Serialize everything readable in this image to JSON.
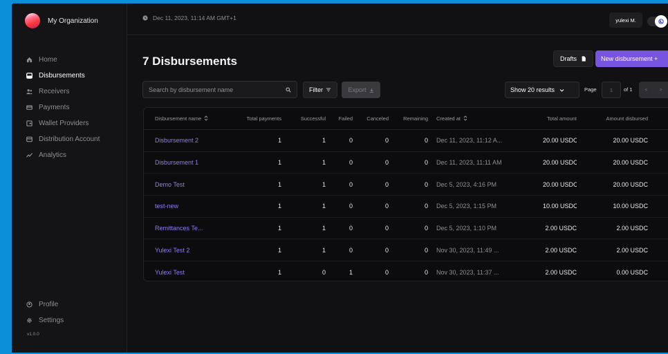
{
  "org": {
    "name": "My Organization"
  },
  "sidebar": {
    "items": [
      {
        "label": "Home",
        "icon": "home-icon"
      },
      {
        "label": "Disbursements",
        "icon": "disbursements-icon",
        "active": true
      },
      {
        "label": "Receivers",
        "icon": "receivers-icon"
      },
      {
        "label": "Payments",
        "icon": "payments-icon"
      },
      {
        "label": "Wallet Providers",
        "icon": "wallet-icon"
      },
      {
        "label": "Distribution Account",
        "icon": "account-icon"
      },
      {
        "label": "Analytics",
        "icon": "analytics-icon"
      }
    ],
    "bottom": [
      {
        "label": "Profile",
        "icon": "profile-icon"
      },
      {
        "label": "Settings",
        "icon": "gear-icon"
      }
    ],
    "version": "v1.0.0"
  },
  "topbar": {
    "datetime": "Dec 11, 2023, 11:14 AM GMT+1",
    "user": "yulexi M."
  },
  "page": {
    "title": "7 Disbursements"
  },
  "actions": {
    "drafts": "Drafts",
    "new": "New disbursement +"
  },
  "toolbar": {
    "search_placeholder": "Search by disbursement name",
    "filter": "Filter",
    "export": "Export",
    "show_results": "Show 20 results",
    "page_label": "Page",
    "page_value": "1",
    "page_of": "of 1"
  },
  "table": {
    "headers": [
      "Disbursement name",
      "Total payments",
      "Successful",
      "Failed",
      "Canceled",
      "Remaining",
      "Created at",
      "Total amount",
      "Amount disbursed"
    ],
    "rows": [
      [
        "Disbursement 2",
        "1",
        "1",
        "0",
        "0",
        "0",
        "Dec 11, 2023, 11:12 A...",
        "20.00 USDC",
        "20.00 USDC"
      ],
      [
        "Disbursement 1",
        "1",
        "1",
        "0",
        "0",
        "0",
        "Dec 11, 2023, 11:11 AM",
        "20.00 USDC",
        "20.00 USDC"
      ],
      [
        "Demo Test",
        "1",
        "1",
        "0",
        "0",
        "0",
        "Dec 5, 2023, 4:16 PM",
        "20.00 USDC",
        "20.00 USDC"
      ],
      [
        "test-new",
        "1",
        "1",
        "0",
        "0",
        "0",
        "Dec 5, 2023, 1:15 PM",
        "10.00 USDC",
        "10.00 USDC"
      ],
      [
        "Remittances Te...",
        "1",
        "1",
        "0",
        "0",
        "0",
        "Dec 5, 2023, 1:10 PM",
        "2.00 USDC",
        "2.00 USDC"
      ],
      [
        "Yulexi Test 2",
        "1",
        "1",
        "0",
        "0",
        "0",
        "Nov 30, 2023, 11:49 ...",
        "2.00 USDC",
        "2.00 USDC"
      ],
      [
        "Yulexi Test",
        "1",
        "0",
        "1",
        "0",
        "0",
        "Nov 30, 2023, 11:37 ...",
        "2.00 USDC",
        "0.00 USDC"
      ]
    ]
  },
  "colors": {
    "accent": "#7755e0",
    "link": "#8f7cf0",
    "frame": "#0c8fd9",
    "background": "#111113"
  }
}
